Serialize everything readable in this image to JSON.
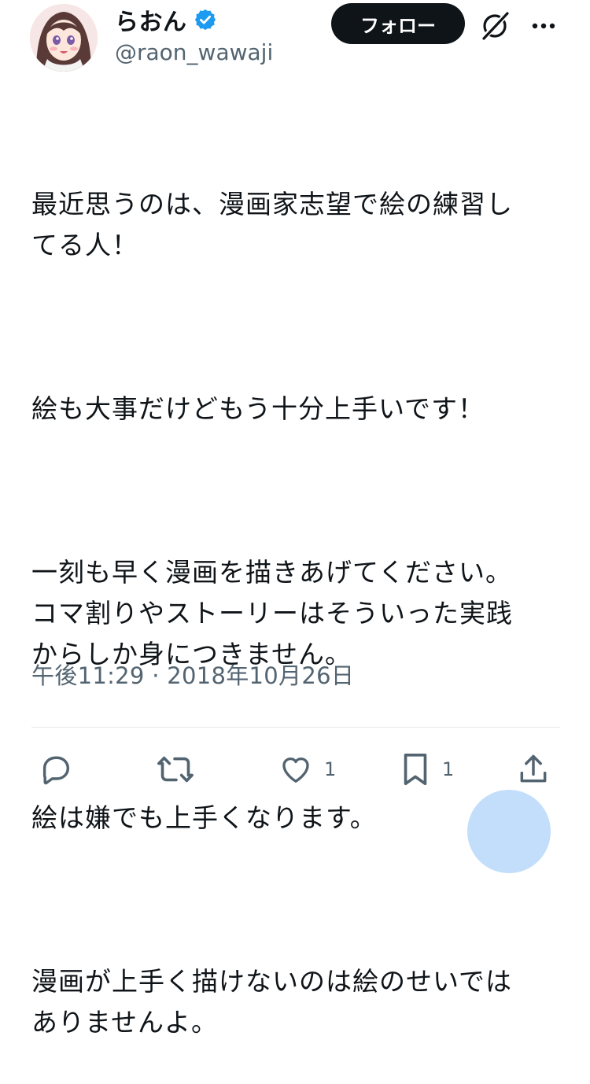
{
  "author": {
    "display_name": "らおん",
    "handle": "@raon_wawaji",
    "verified": true
  },
  "header": {
    "follow_label": "フォロー"
  },
  "tweet": {
    "paragraphs": [
      "最近思うのは、漫画家志望で絵の練習し\nてる人！",
      "絵も大事だけどもう十分上手いです！",
      "一刻も早く漫画を描きあげてください。\nコマ割りやストーリーはそういった実践\nからしか身につきません。",
      "絵は嫌でも上手くなります。",
      "漫画が上手く描けないのは絵のせいでは\nありませんよ。"
    ],
    "timestamp": "午後11:29 · 2018年10月26日"
  },
  "actions": {
    "reply_icon": "reply-icon",
    "retweet_icon": "retweet-icon",
    "like_icon": "heart-icon",
    "like_count": "1",
    "bookmark_icon": "bookmark-icon",
    "bookmark_count": "1",
    "share_icon": "share-icon"
  },
  "colors": {
    "verified_blue": "#1d9bf0",
    "text_primary": "#0f1419",
    "text_secondary": "#536471",
    "follow_button_bg": "#0f1419"
  }
}
